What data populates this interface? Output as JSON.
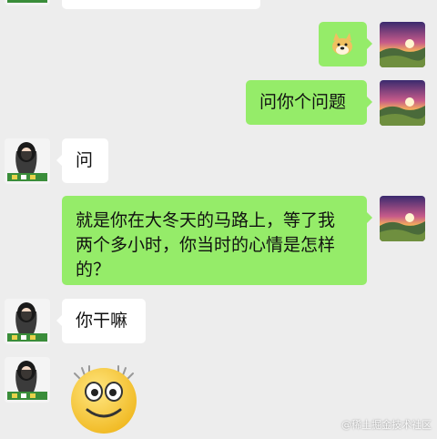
{
  "messages": [
    {
      "side": "left",
      "type": "text",
      "text": ""
    },
    {
      "side": "right",
      "type": "sticker",
      "sticker": "doge-emoji"
    },
    {
      "side": "right",
      "type": "text",
      "text": "问你个问题"
    },
    {
      "side": "left",
      "type": "text",
      "text": "问"
    },
    {
      "side": "right",
      "type": "text",
      "text_line1": "就是你在大冬天的马路上，等了我",
      "text_line2": "两个多小时，你当时的心情是怎样",
      "text_line3": "的？"
    },
    {
      "side": "left",
      "type": "text",
      "text": "你干嘛"
    },
    {
      "side": "left",
      "type": "sticker",
      "sticker": "smiling-face-emoji"
    }
  ],
  "avatars": {
    "left": "girl-avatar",
    "right": "sunset-landscape-avatar"
  },
  "colors": {
    "background": "#ededed",
    "outgoing_bubble": "#95ec69",
    "incoming_bubble": "#ffffff"
  },
  "watermark": "@稀土掘金技术社区"
}
